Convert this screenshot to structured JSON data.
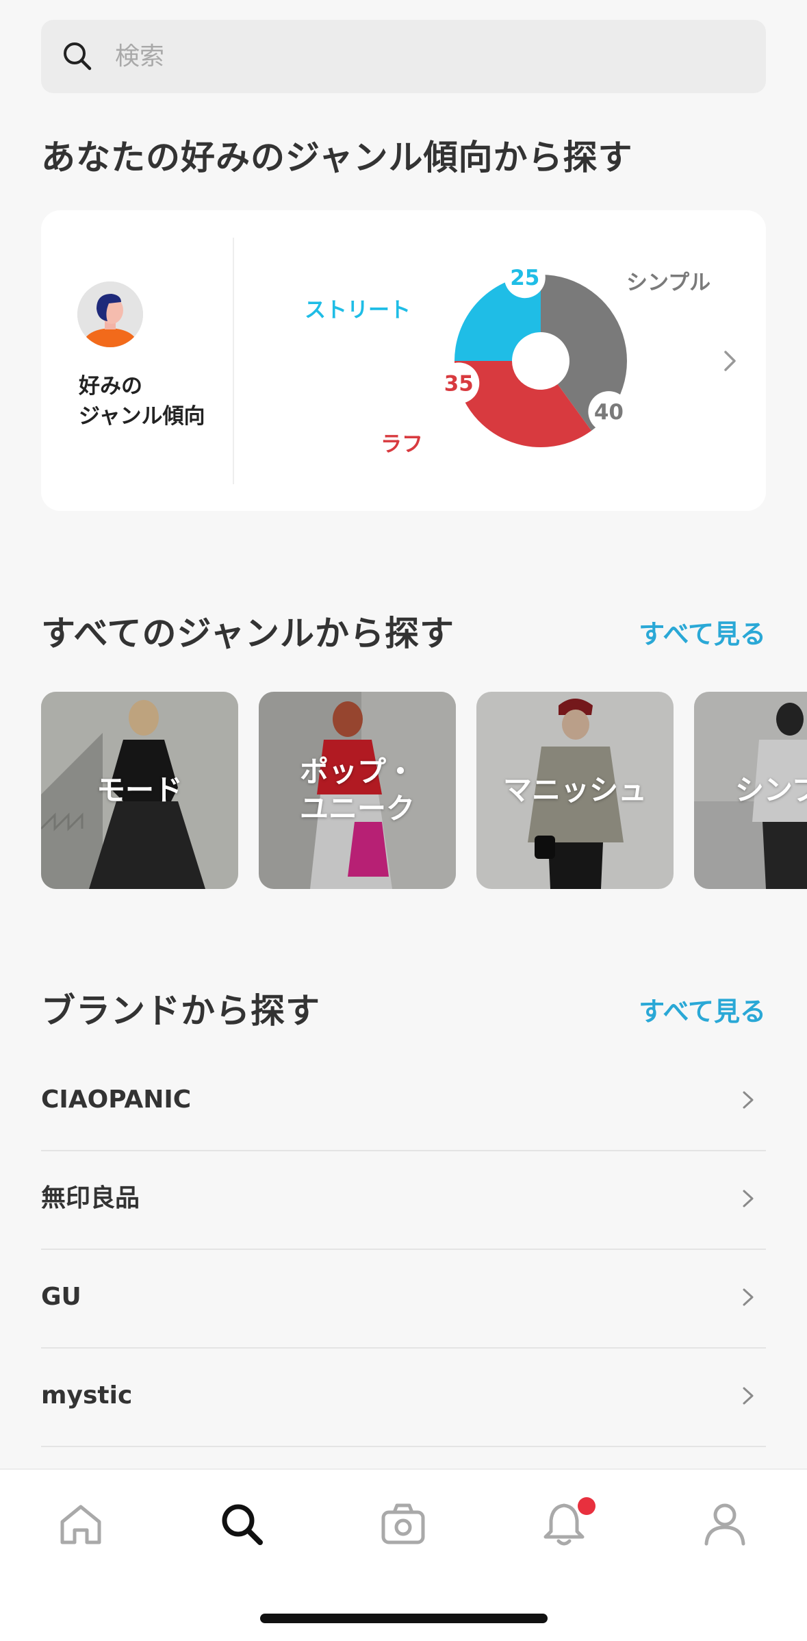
{
  "search": {
    "placeholder": "検索",
    "icon": "search-icon"
  },
  "taste": {
    "title": "あなたの好みのジャンル傾向から探す",
    "card_label": "好みの\nジャンル傾向",
    "colors": {
      "street": "#1fbde6",
      "simple": "#7a7a7a",
      "rough": "#d83a3f"
    }
  },
  "chart_data": {
    "type": "pie",
    "labels": [
      "シンプル",
      "ラフ",
      "ストリート"
    ],
    "values": [
      40,
      35,
      25
    ],
    "colors": [
      "#7a7a7a",
      "#d83a3f",
      "#1fbde6"
    ]
  },
  "genres": {
    "title": "すべてのジャンルから探す",
    "see_all": "すべて見る",
    "items": [
      {
        "label": "モード"
      },
      {
        "label": "ポップ・\nユニーク"
      },
      {
        "label": "マニッシュ"
      },
      {
        "label": "シンプ"
      }
    ]
  },
  "brands": {
    "title": "ブランドから探す",
    "see_all": "すべて見る",
    "items": [
      {
        "name": "CIAOPANIC"
      },
      {
        "name": "無印良品"
      },
      {
        "name": "GU"
      },
      {
        "name": "mystic"
      }
    ]
  },
  "tabbar": {
    "items": [
      {
        "icon": "home-icon",
        "active": false
      },
      {
        "icon": "search-icon",
        "active": true
      },
      {
        "icon": "camera-icon",
        "active": false
      },
      {
        "icon": "bell-icon",
        "active": false,
        "badge": true
      },
      {
        "icon": "profile-icon",
        "active": false
      }
    ]
  }
}
